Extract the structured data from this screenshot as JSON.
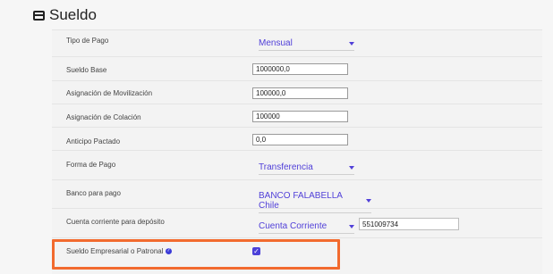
{
  "section": {
    "title": "Sueldo",
    "icon": "credit-card-icon"
  },
  "fields": {
    "tipo_pago": {
      "label": "Tipo de Pago",
      "value": "Mensual"
    },
    "sueldo_base": {
      "label": "Sueldo Base",
      "value": "1000000,0"
    },
    "asig_movilizacion": {
      "label": "Asignación de Movilización",
      "value": "100000,0"
    },
    "asig_colacion": {
      "label": "Asignación de Colación",
      "value": "100000"
    },
    "anticipo": {
      "label": "Anticipo Pactado",
      "value": "0,0"
    },
    "forma_pago": {
      "label": "Forma de Pago",
      "value": "Transferencia"
    },
    "banco": {
      "label": "Banco para pago",
      "value": "BANCO FALABELLA Chile"
    },
    "cuenta": {
      "label": "Cuenta corriente para depósito",
      "type_value": "Cuenta Corriente",
      "number": "551009734"
    },
    "empresarial": {
      "label": "Sueldo Empresarial o Patronal",
      "checked": true
    }
  },
  "colors": {
    "accent": "#5140d8",
    "highlight": "#f26a2e"
  }
}
